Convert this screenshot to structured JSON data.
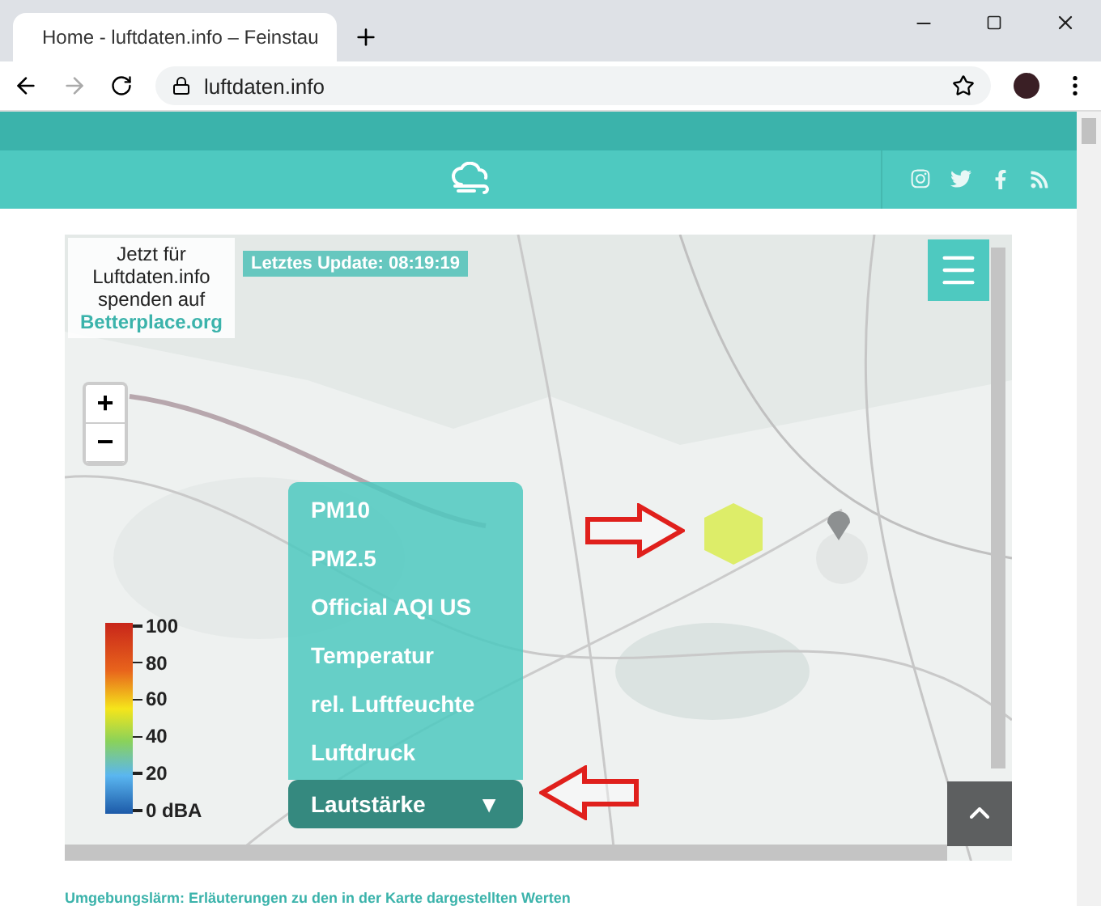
{
  "browser": {
    "tab_title": "Home - luftdaten.info – Feinstau",
    "address": "luftdaten.info"
  },
  "map": {
    "donation": {
      "text": "Jetzt für Luftdaten.info spenden auf",
      "link": "Betterplace.org"
    },
    "update_badge": "Letztes Update: 08:19:19",
    "zoom": [
      "+",
      "−"
    ],
    "menu": {
      "toggle": "▼",
      "items": [
        {
          "label": "PM10",
          "selected": false
        },
        {
          "label": "PM2.5",
          "selected": false
        },
        {
          "label": "Official AQI US",
          "selected": false
        },
        {
          "label": "Temperatur",
          "selected": false
        },
        {
          "label": "rel. Luftfeuchte",
          "selected": false
        },
        {
          "label": "Luftdruck",
          "selected": false
        },
        {
          "label": "Lautstärke",
          "selected": true
        }
      ]
    },
    "legend": [
      "100",
      "80",
      "60",
      "40",
      "20",
      "0 dBA"
    ]
  },
  "footer_link": "Umgebungslärm: Erläuterungen zu den in der Karte dargestellten Werten"
}
